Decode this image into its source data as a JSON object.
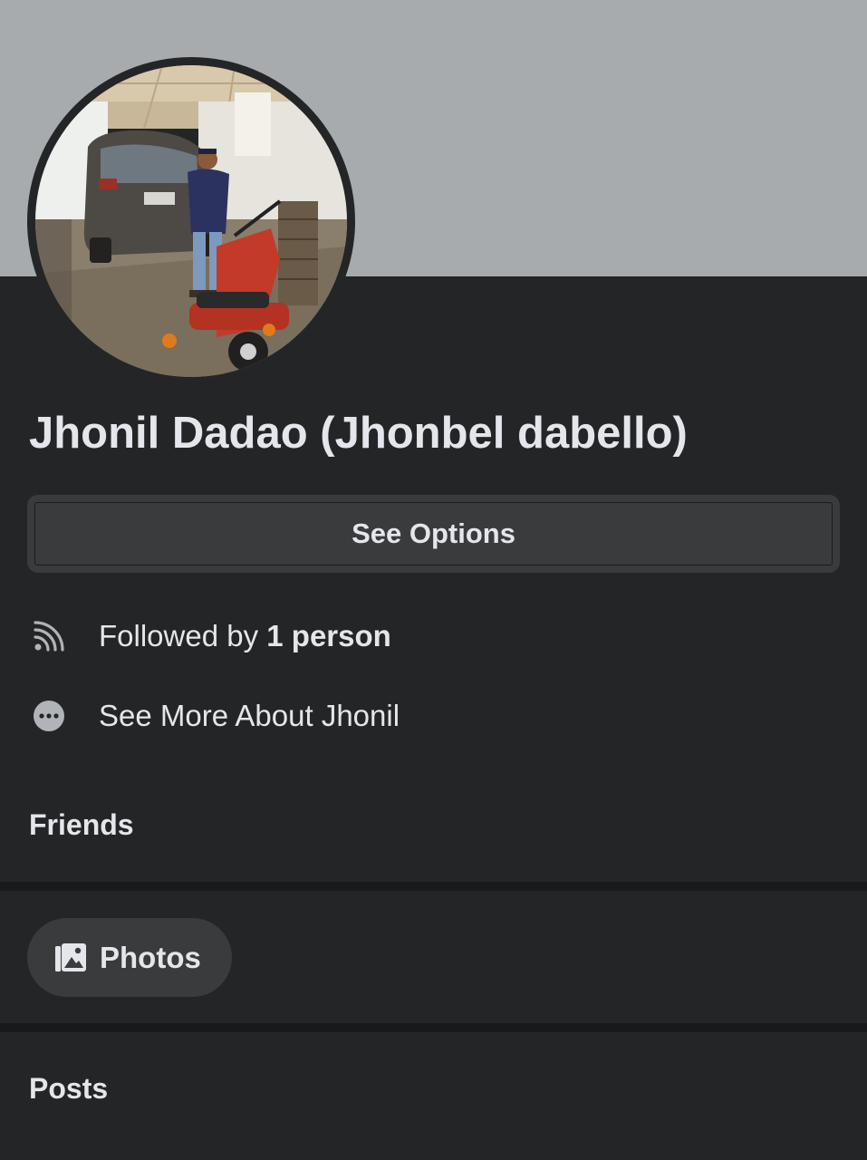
{
  "profile": {
    "name": "Jhonil Dadao (Jhonbel dabello)"
  },
  "actions": {
    "see_options_label": "See Options"
  },
  "info": {
    "followed_prefix": "Followed by ",
    "followed_count": "1 person",
    "see_more_label": "See More About Jhonil"
  },
  "sections": {
    "friends_title": "Friends",
    "photos_label": "Photos",
    "posts_title": "Posts"
  },
  "icons": {
    "followers": "rss-feed-icon",
    "more": "more-dots-icon",
    "photos": "photo-gallery-icon"
  },
  "colors": {
    "background": "#242526",
    "cover": "#a7abae",
    "button": "#3a3b3c",
    "text": "#e4e6eb",
    "divider": "#18191a"
  }
}
